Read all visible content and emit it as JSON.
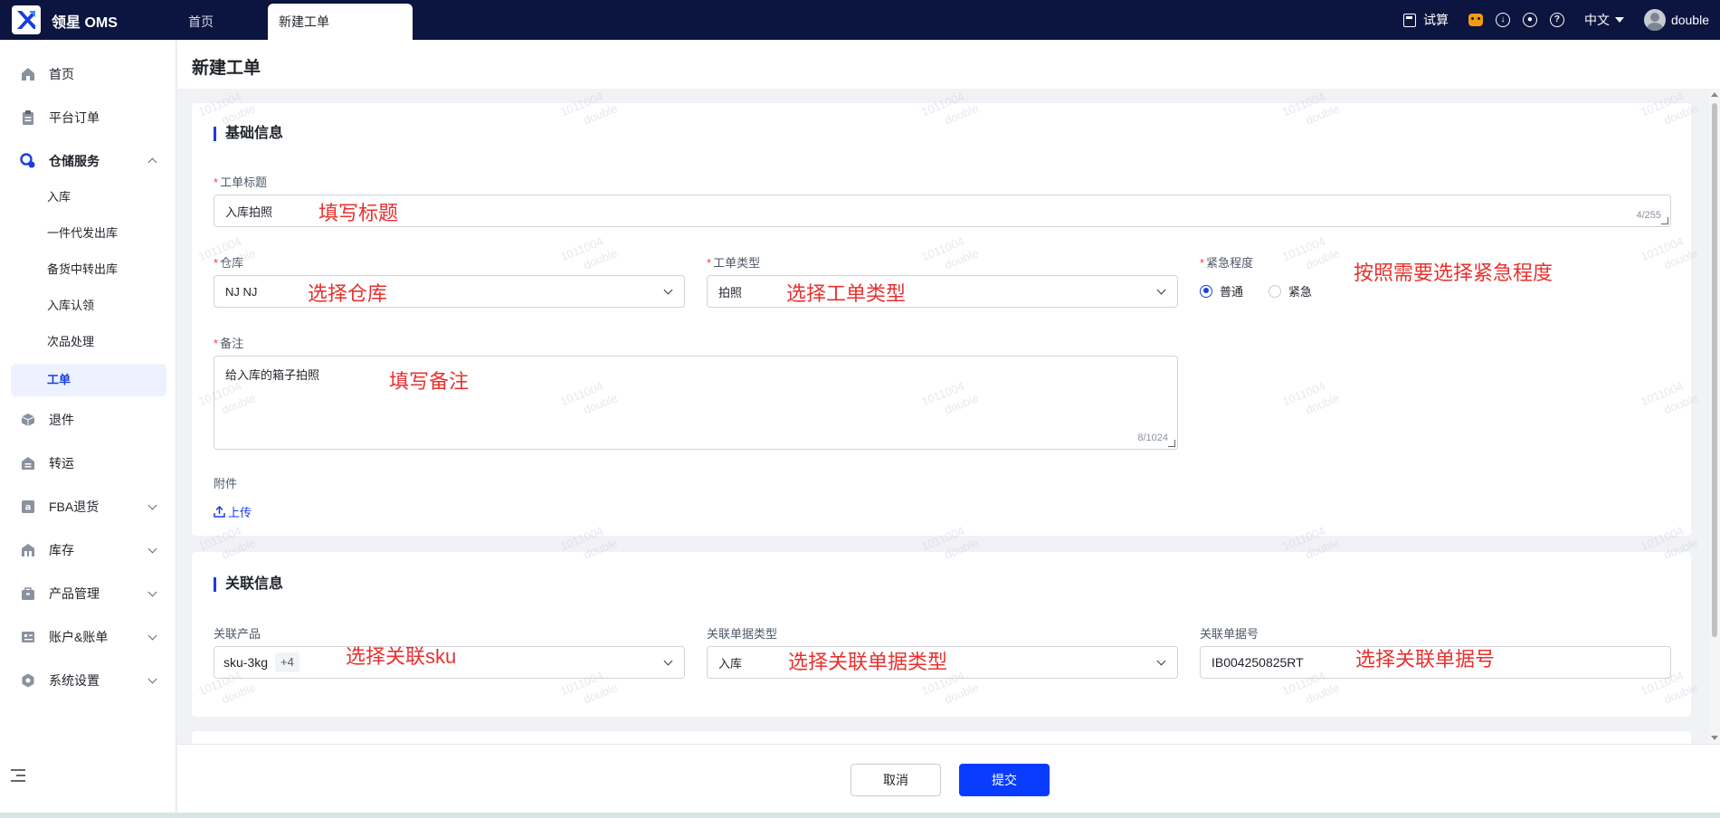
{
  "topbar": {
    "brand": "领星 OMS",
    "tabs": [
      {
        "label": "首页"
      },
      {
        "label": "新建工单"
      }
    ],
    "calc_label": "试算",
    "language": "中文",
    "username": "double"
  },
  "sidebar": {
    "items": [
      {
        "label": "首页",
        "icon": "home-icon"
      },
      {
        "label": "平台订单",
        "icon": "clipboard-icon"
      },
      {
        "label": "仓储服务",
        "icon": "warehouse-service-icon",
        "expanded": true
      },
      {
        "label": "退件",
        "icon": "return-icon"
      },
      {
        "label": "转运",
        "icon": "transfer-icon"
      },
      {
        "label": "FBA退货",
        "icon": "amazon-icon"
      },
      {
        "label": "库存",
        "icon": "inventory-icon"
      },
      {
        "label": "产品管理",
        "icon": "product-icon"
      },
      {
        "label": "账户&账单",
        "icon": "account-icon"
      },
      {
        "label": "系统设置",
        "icon": "settings-icon"
      }
    ],
    "sub_items": [
      {
        "label": "入库"
      },
      {
        "label": "一件代发出库"
      },
      {
        "label": "备货中转出库"
      },
      {
        "label": "入库认领"
      },
      {
        "label": "次品处理"
      },
      {
        "label": "工单",
        "active": true
      }
    ]
  },
  "page": {
    "title": "新建工单"
  },
  "basic": {
    "section_title": "基础信息",
    "title_label": "工单标题",
    "title_value": "入库拍照",
    "title_counter": "4/255",
    "warehouse_label": "仓库",
    "warehouse_value": "NJ NJ",
    "type_label": "工单类型",
    "type_value": "拍照",
    "urgency_label": "紧急程度",
    "urgency_options": [
      "普通",
      "紧急"
    ],
    "urgency_selected": "普通",
    "remark_label": "备注",
    "remark_value": "给入库的箱子拍照",
    "remark_counter": "8/1024",
    "attachment_label": "附件",
    "upload_label": "上传"
  },
  "related": {
    "section_title": "关联信息",
    "product_label": "关联产品",
    "product_value": "sku-3kg",
    "product_more": "+4",
    "doc_type_label": "关联单据类型",
    "doc_type_value": "入库",
    "doc_no_label": "关联单据号",
    "doc_no_value": "IB004250825RT"
  },
  "annotations": {
    "title": "填写标题",
    "warehouse": "选择仓库",
    "type": "选择工单类型",
    "urgency": "按照需要选择紧急程度",
    "remark": "填写备注",
    "product": "选择关联sku",
    "doc_type": "选择关联单据类型",
    "doc_no": "选择关联单据号"
  },
  "watermark": {
    "line1": "1011004",
    "line2": "double"
  },
  "footer": {
    "cancel_label": "取消",
    "submit_label": "提交"
  },
  "colors": {
    "topbar_bg": "#0b1540",
    "primary": "#0a3cff",
    "annotation": "#e8312f",
    "required": "#f53f3f"
  }
}
